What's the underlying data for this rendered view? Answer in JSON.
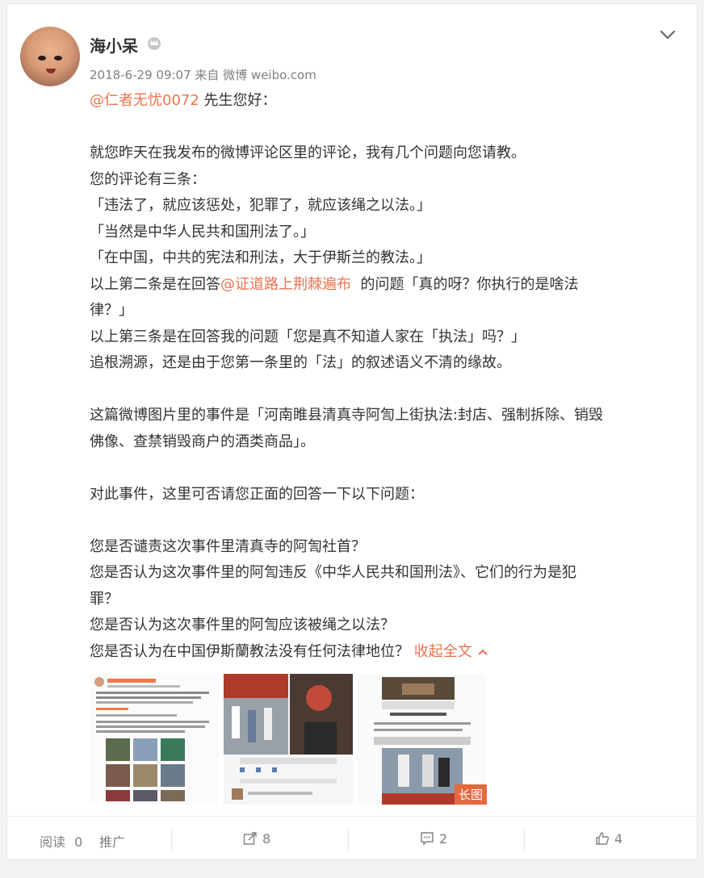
{
  "post": {
    "author": "海小呆",
    "meta": "2018-6-29 09:07 来自 微博 weibo.com",
    "lines": [
      {
        "mention": "@仁者无忧0072",
        "text": " 先生您好："
      },
      {
        "blank": true
      },
      {
        "text": "就您昨天在我发布的微博评论区里的评论，我有几个问题向您请教。"
      },
      {
        "text": "您的评论有三条："
      },
      {
        "text": "「违法了，就应该惩处，犯罪了，就应该绳之以法。」"
      },
      {
        "text": "「当然是中华人民共和国刑法了。」"
      },
      {
        "text": "「在中国，中共的宪法和刑法，大于伊斯兰的教法。」"
      },
      {
        "pre": "以上第二条是在回答",
        "mention": "@证道路上荆棘遍布",
        "text": "  的问题「真的呀？你执行的是啥法"
      },
      {
        "text": "律？」"
      },
      {
        "text": "以上第三条是在回答我的问题「您是真不知道人家在「执法」吗？」"
      },
      {
        "text": "追根溯源，还是由于您第一条里的「法」的叙述语义不清的缘故。"
      },
      {
        "blank": true
      },
      {
        "text": "这篇微博图片里的事件是「河南睢县清真寺阿訇上街执法:封店、强制拆除、销毁"
      },
      {
        "text": "佛像、查禁销毁商户的酒类商品」。"
      },
      {
        "blank": true
      },
      {
        "text": "对此事件，这里可否请您正面的回答一下以下问题："
      },
      {
        "blank": true
      },
      {
        "text": "您是否谴责这次事件里清真寺的阿訇社首？"
      },
      {
        "text": "您是否认为这次事件里的阿訇违反《中华人民共和国刑法》、它们的行为是犯"
      },
      {
        "text": "罪？"
      },
      {
        "text": "您是否认为这次事件里的阿訇应该被绳之以法？"
      },
      {
        "text": "您是否认为在中国伊斯蘭教法没有任何法律地位？ ",
        "link": "收起全文"
      }
    ],
    "long_image_badge": "长图"
  },
  "footer": {
    "read_label": "阅读",
    "read_count": "0",
    "promote_label": "推广",
    "forward_count": "8",
    "comment_count": "2",
    "like_count": "4"
  },
  "colors": {
    "accent": "#eb7350",
    "badge": "#e4693e"
  }
}
